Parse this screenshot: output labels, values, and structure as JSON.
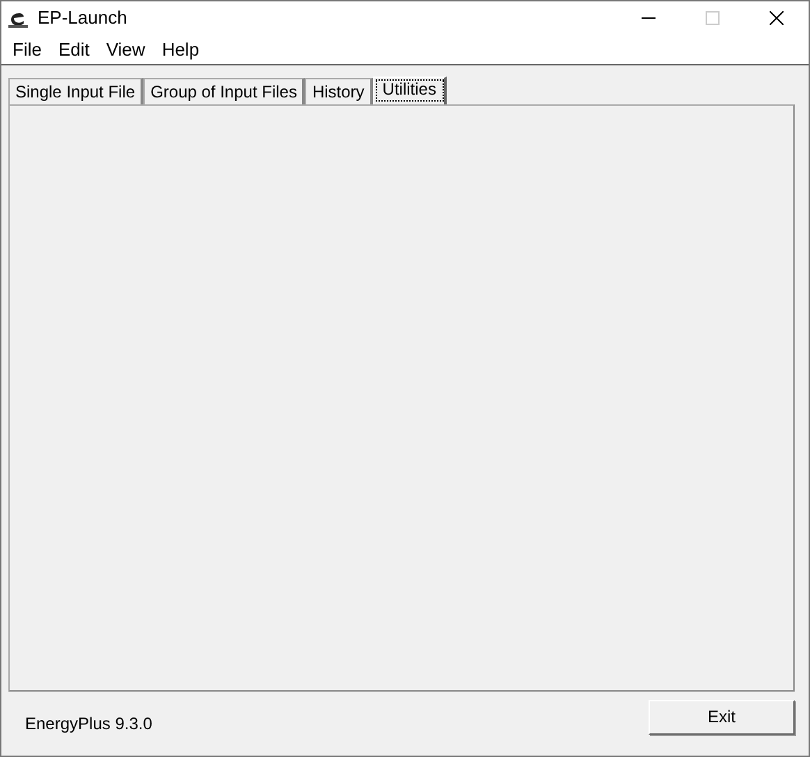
{
  "window": {
    "title": "EP-Launch",
    "maximize_enabled": false
  },
  "menu": [
    "File",
    "Edit",
    "View",
    "Help"
  ],
  "tabs": [
    {
      "label": "Single Input File",
      "selected": false
    },
    {
      "label": "Group of Input Files",
      "selected": false
    },
    {
      "label": "History",
      "selected": false
    },
    {
      "label": "Utilities",
      "selected": true
    }
  ],
  "status_text": "EnergyPlus 9.3.0",
  "buttons": [
    "Exit"
  ]
}
